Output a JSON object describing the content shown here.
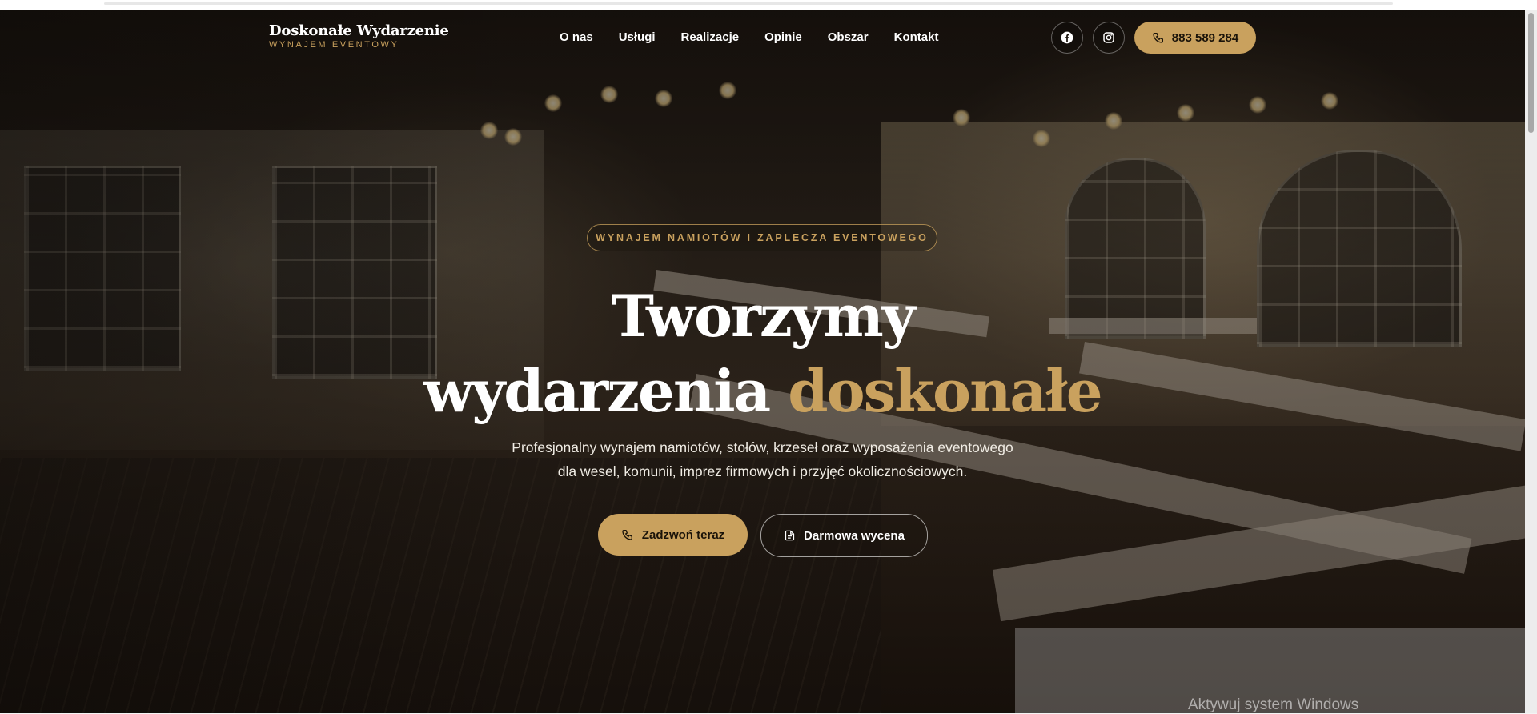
{
  "brand": {
    "title": "Doskonałe Wydarzenie",
    "subtitle": "WYNAJEM EVENTOWY"
  },
  "nav": {
    "items": [
      {
        "label": "O nas"
      },
      {
        "label": "Usługi"
      },
      {
        "label": "Realizacje"
      },
      {
        "label": "Opinie"
      },
      {
        "label": "Obszar"
      },
      {
        "label": "Kontakt"
      }
    ]
  },
  "header_actions": {
    "facebook_icon": "facebook-icon",
    "instagram_icon": "instagram-icon",
    "phone_label": "883 589 284"
  },
  "hero": {
    "badge": "WYNAJEM NAMIOTÓW I ZAPLECZA EVENTOWEGO",
    "title_line1": "Tworzymy",
    "title_line2_plain": "wydarzenia ",
    "title_line2_accent": "doskonałe",
    "description_line1": "Profesjonalny wynajem namiotów, stołów, krzeseł oraz wyposażenia eventowego",
    "description_line2": "dla wesel, komunii, imprez firmowych i przyjęć okolicznościowych.",
    "cta_call": "Zadzwoń teraz",
    "cta_quote": "Darmowa wycena"
  },
  "overlay": {
    "windows_activation": "Aktywuj system Windows"
  },
  "colors": {
    "accent": "#c9a15e",
    "text_light": "#ffffff",
    "background_dark": "#1a130d"
  }
}
